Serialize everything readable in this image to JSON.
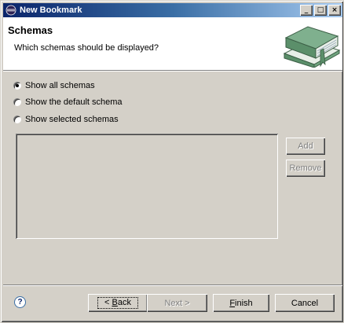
{
  "window": {
    "title": "New Bookmark",
    "controls": {
      "minimize": "_",
      "maximize": "□",
      "close": "×"
    }
  },
  "banner": {
    "heading": "Schemas",
    "description": "Which schemas should be displayed?",
    "image_icon": "books-icon"
  },
  "options": [
    {
      "label": "Show all schemas",
      "checked": true
    },
    {
      "label": "Show the default schema",
      "checked": false
    },
    {
      "label": "Show selected schemas",
      "checked": false
    }
  ],
  "list": {
    "items": []
  },
  "side_buttons": {
    "add": "Add",
    "remove": "Remove"
  },
  "footer": {
    "help_icon": "help-icon",
    "help_glyph": "?",
    "back_mnemonic": "< ",
    "back_accel": "B",
    "back_rest": "ack",
    "next": "Next >",
    "finish_accel": "F",
    "finish_rest": "inish",
    "cancel": "Cancel"
  },
  "colors": {
    "face": "#d4d0c8",
    "title_start": "#0a246a",
    "title_end": "#a6caf0",
    "book_green": "#5b8f6a"
  }
}
